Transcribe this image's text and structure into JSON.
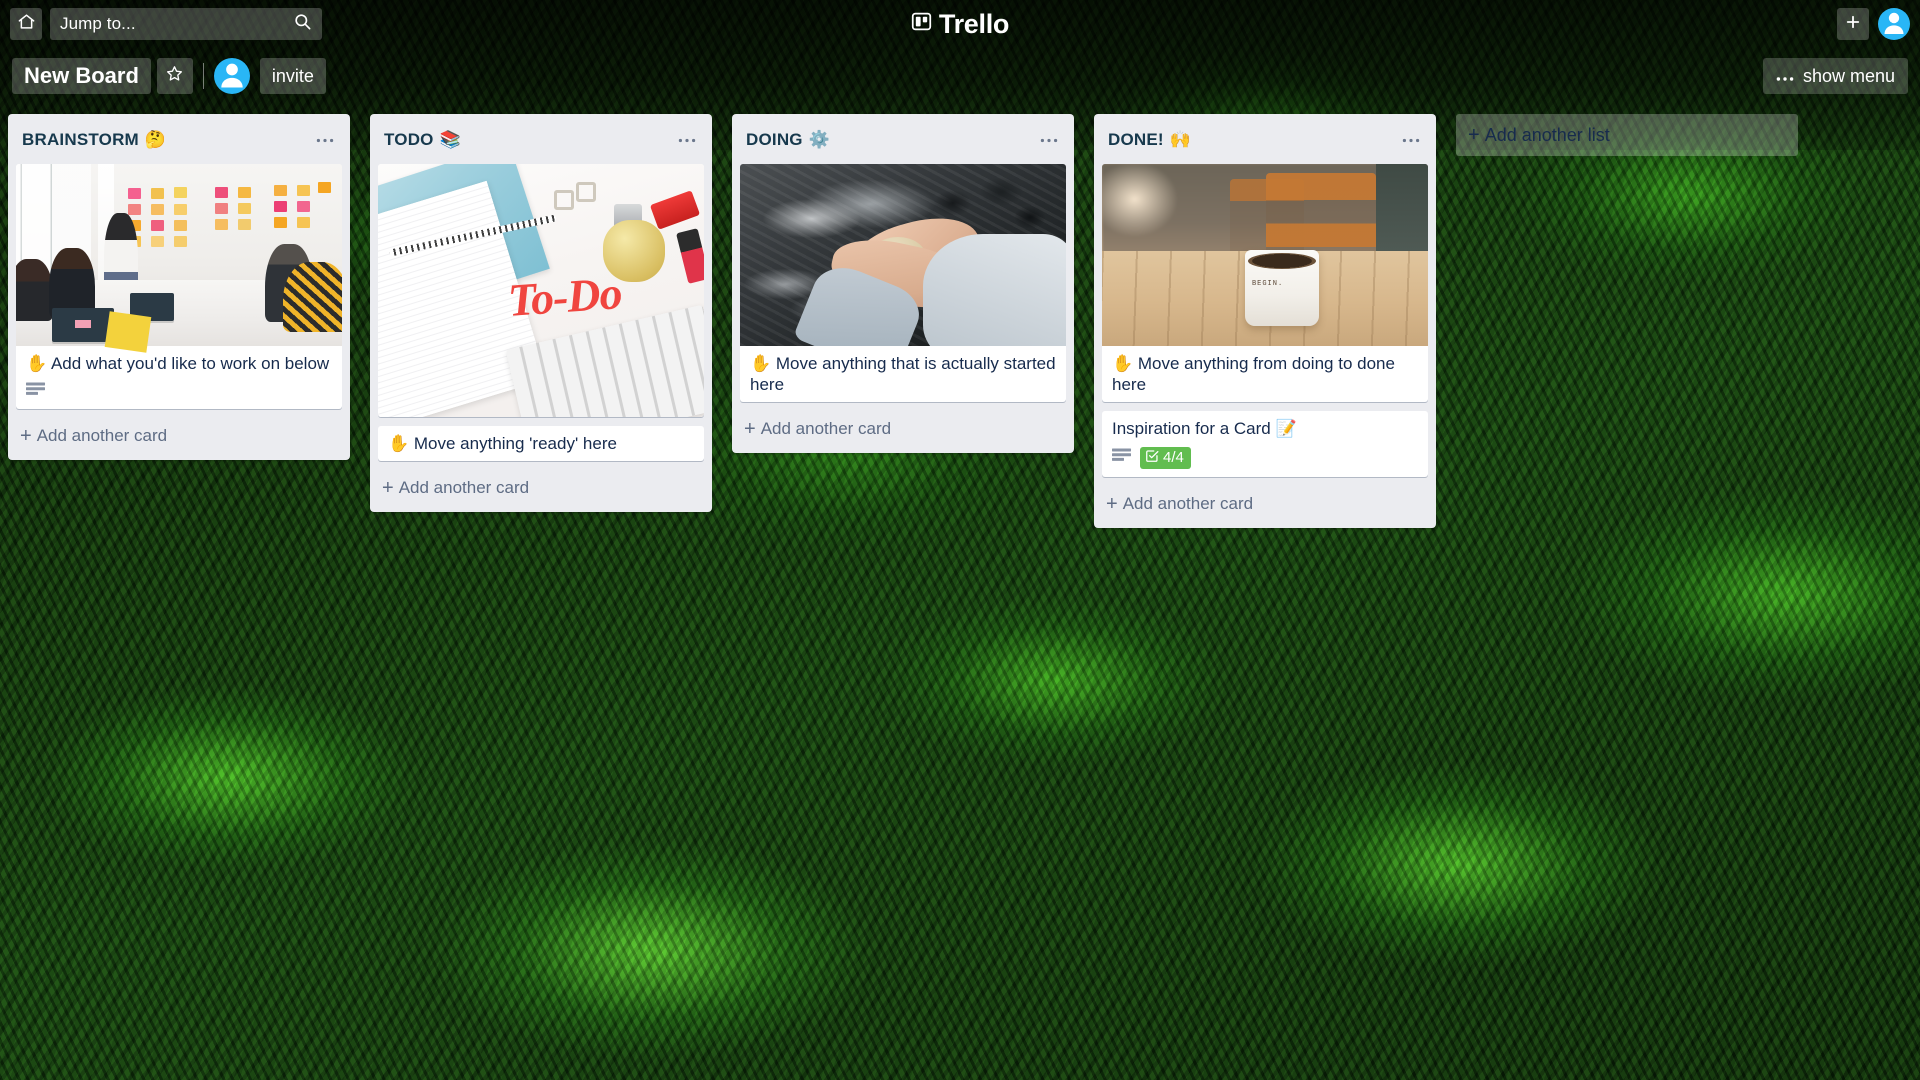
{
  "app": {
    "name": "Trello",
    "logo_icon": "trello-board-icon"
  },
  "top_bar": {
    "home_icon": "home-icon",
    "search": {
      "placeholder": "Jump to...",
      "value": "Jump to...",
      "icon": "search-icon"
    },
    "add_button_label": "+",
    "add_icon": "plus-icon",
    "profile_icon": "user-avatar-icon"
  },
  "board_header": {
    "title": "New Board",
    "star_icon": "star-outline-icon",
    "member_avatar_icon": "user-avatar-icon",
    "invite_label": "invite",
    "show_menu_label": "show menu",
    "show_menu_icon": "ellipsis-icon"
  },
  "colors": {
    "list_background": "#ebecf0",
    "card_background": "#ffffff",
    "list_title": "#17394d",
    "card_text": "#172b4d",
    "muted_text": "#5e6c84",
    "checklist_badge": "#61bd4f",
    "nav_overlay": "rgba(255,255,255,0.22)"
  },
  "lists": [
    {
      "title": "BRAINSTORM",
      "emoji": "🤔",
      "menu_icon": "ellipsis-icon",
      "add_card_label": "Add another card",
      "cards": [
        {
          "cover": "brainstorm-meeting-photo",
          "text": "✋ Add what you'd like to work on below",
          "has_description": true,
          "checklist": null
        }
      ]
    },
    {
      "title": "TODO",
      "emoji": "📚",
      "menu_icon": "ellipsis-icon",
      "add_card_label": "Add another card",
      "cards": [
        {
          "cover": "todo-desk-flatlay-photo",
          "text": null,
          "has_description": false,
          "checklist": null
        },
        {
          "cover": null,
          "text": "✋ Move anything 'ready' here",
          "has_description": false,
          "checklist": null
        }
      ]
    },
    {
      "title": "DOING",
      "emoji": "⚙️",
      "menu_icon": "ellipsis-icon",
      "add_card_label": "Add another card",
      "cards": [
        {
          "cover": "hands-kneading-dough-photo",
          "text": "✋ Move anything that is actually started here",
          "has_description": false,
          "checklist": null
        }
      ]
    },
    {
      "title": "DONE!",
      "emoji": "🙌",
      "menu_icon": "ellipsis-icon",
      "add_card_label": "Add another card",
      "cards": [
        {
          "cover": "coffee-mug-on-table-photo",
          "text": "✋ Move anything from doing to done here",
          "has_description": false,
          "checklist": null
        },
        {
          "cover": null,
          "text": "Inspiration for a Card 📝",
          "has_description": true,
          "checklist": "4/4"
        }
      ]
    }
  ],
  "add_another_list": {
    "label": "Add another list",
    "plus": "+"
  },
  "card_icons": {
    "description_icon": "description-lines-icon",
    "checklist_icon": "checklist-check-icon"
  }
}
